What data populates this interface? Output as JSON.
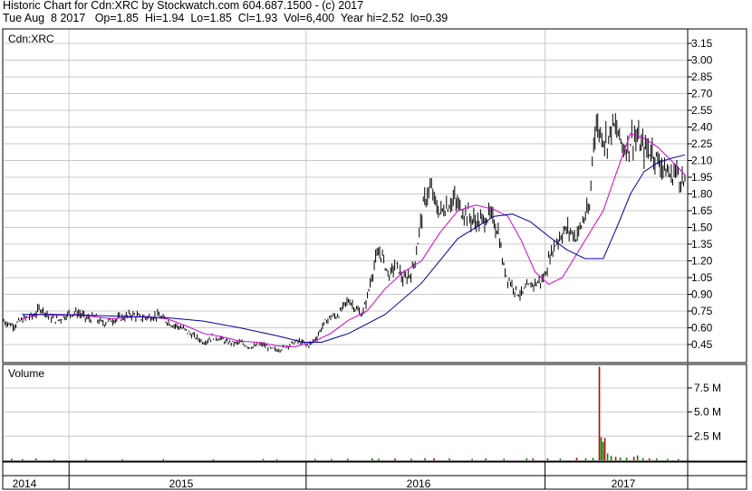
{
  "header": {
    "line1": "Historic Chart for Cdn:XRC by Stockwatch.com 604.687.1500 - (c) 2017",
    "line2": "Tue Aug  8 2017   Op=1.85  Hi=1.94  Lo=1.85  Cl=1.93  Vol=6,400  Year hi=2.52  lo=0.39"
  },
  "chart_data": [
    {
      "type": "line",
      "title": "Cdn:XRC",
      "ylim": [
        0.3,
        3.25
      ],
      "y_ticks": [
        "3.15",
        "3.00",
        "2.85",
        "2.70",
        "2.55",
        "2.40",
        "2.25",
        "2.10",
        "1.95",
        "1.80",
        "1.65",
        "1.50",
        "1.35",
        "1.20",
        "1.05",
        "0.90",
        "0.75",
        "0.60",
        "0.45"
      ],
      "x_labels": [
        "2014",
        "2015",
        "2016",
        "2017"
      ],
      "grid": true,
      "series": [
        {
          "style": "price-bars",
          "color": "#000000",
          "x": [
            0,
            5,
            10,
            15,
            20,
            25,
            30,
            35,
            40,
            45,
            50,
            55,
            60,
            65,
            70,
            75,
            80,
            85,
            90,
            95,
            100,
            105,
            110,
            115,
            120,
            125,
            130,
            135,
            140,
            145,
            150,
            155,
            160,
            165,
            170,
            175,
            180,
            185,
            190,
            195,
            200,
            205,
            210,
            215,
            220,
            225,
            230,
            235,
            240,
            245,
            250,
            255,
            260,
            265,
            270,
            275,
            280,
            285,
            290,
            295,
            300,
            305,
            310,
            315,
            320,
            325,
            330,
            335,
            340,
            345,
            350,
            355,
            360,
            365,
            370,
            375,
            380,
            385,
            390,
            395,
            400,
            405,
            410,
            415,
            420,
            425,
            430,
            435,
            440,
            445,
            450,
            455,
            460,
            465,
            470,
            475,
            480,
            485,
            490,
            495,
            500,
            505,
            510,
            515,
            520,
            525,
            530,
            535,
            540,
            545,
            550,
            555,
            560,
            565,
            570,
            575,
            580,
            585,
            590,
            595,
            600,
            605,
            610,
            615,
            620,
            625,
            630,
            635,
            640,
            645,
            650,
            655,
            660,
            665,
            670,
            675,
            680,
            685,
            690,
            695,
            700,
            705,
            710,
            715,
            720,
            725,
            730,
            735,
            740,
            745,
            750
          ],
          "values": [
            0.66,
            0.64,
            0.62,
            0.64,
            0.67,
            0.69,
            0.7,
            0.72,
            0.78,
            0.75,
            0.7,
            0.68,
            0.67,
            0.69,
            0.72,
            0.73,
            0.74,
            0.72,
            0.69,
            0.68,
            0.7,
            0.66,
            0.64,
            0.66,
            0.67,
            0.68,
            0.69,
            0.7,
            0.72,
            0.71,
            0.69,
            0.69,
            0.7,
            0.7,
            0.71,
            0.68,
            0.66,
            0.63,
            0.62,
            0.6,
            0.58,
            0.55,
            0.52,
            0.5,
            0.47,
            0.49,
            0.52,
            0.51,
            0.5,
            0.47,
            0.47,
            0.46,
            0.47,
            0.45,
            0.43,
            0.43,
            0.44,
            0.45,
            0.43,
            0.41,
            0.4,
            0.41,
            0.43,
            0.45,
            0.47,
            0.48,
            0.46,
            0.44,
            0.47,
            0.52,
            0.6,
            0.66,
            0.7,
            0.7,
            0.73,
            0.8,
            0.85,
            0.8,
            0.75,
            0.72,
            0.86,
            1.06,
            1.22,
            1.28,
            1.16,
            1.06,
            1.16,
            1.13,
            1.02,
            1.06,
            1.11,
            1.31,
            1.6,
            1.78,
            1.85,
            1.72,
            1.63,
            1.67,
            1.71,
            1.75,
            1.7,
            1.64,
            1.63,
            1.57,
            1.55,
            1.55,
            1.58,
            1.61,
            1.55,
            1.45,
            1.15,
            1.05,
            0.98,
            0.92,
            0.9,
            0.95,
            0.98,
            1.0,
            1.01,
            1.05,
            1.2,
            1.32,
            1.39,
            1.45,
            1.48,
            1.46,
            1.42,
            1.5,
            1.6,
            1.65,
            2.4,
            2.38,
            2.32,
            2.27,
            2.42,
            2.36,
            2.26,
            2.2,
            2.28,
            2.32,
            2.25,
            2.2,
            2.2,
            2.18,
            2.1,
            2.06,
            2.0,
            1.95,
            2.02,
            1.95,
            1.88
          ]
        },
        {
          "style": "moving-average",
          "color": "#d000d0",
          "x": [
            20,
            40,
            60,
            80,
            100,
            120,
            140,
            160,
            180,
            200,
            220,
            240,
            260,
            280,
            300,
            320,
            340,
            360,
            380,
            400,
            420,
            440,
            460,
            480,
            500,
            520,
            540,
            555,
            570,
            585,
            600,
            615,
            630,
            645,
            660,
            675,
            690,
            705,
            720,
            735,
            750
          ],
          "values": [
            0.68,
            0.72,
            0.71,
            0.72,
            0.7,
            0.68,
            0.7,
            0.7,
            0.68,
            0.62,
            0.55,
            0.52,
            0.48,
            0.47,
            0.44,
            0.43,
            0.47,
            0.55,
            0.67,
            0.75,
            0.95,
            1.1,
            1.2,
            1.45,
            1.65,
            1.7,
            1.66,
            1.6,
            1.38,
            1.1,
            0.99,
            1.05,
            1.25,
            1.45,
            1.65,
            2.0,
            2.34,
            2.3,
            2.22,
            2.1,
            1.97
          ]
        },
        {
          "style": "moving-average",
          "color": "#0000a0",
          "x": [
            20,
            60,
            100,
            140,
            180,
            220,
            260,
            300,
            330,
            350,
            380,
            420,
            460,
            500,
            540,
            560,
            580,
            600,
            620,
            640,
            660,
            675,
            690,
            705,
            720,
            735,
            750
          ],
          "values": [
            0.72,
            0.72,
            0.71,
            0.7,
            0.69,
            0.66,
            0.6,
            0.53,
            0.47,
            0.47,
            0.55,
            0.72,
            1.0,
            1.4,
            1.6,
            1.62,
            1.55,
            1.42,
            1.3,
            1.22,
            1.22,
            1.5,
            1.8,
            2.0,
            2.08,
            2.12,
            2.15
          ]
        }
      ]
    },
    {
      "type": "bar",
      "title": "Volume",
      "ylim": [
        0,
        10000000
      ],
      "y_ticks": [
        "7.5 M",
        "5.0 M",
        "2.5 M"
      ],
      "grid": true,
      "bars": [
        {
          "x": 8,
          "v": 150000
        },
        {
          "x": 20,
          "v": 120000
        },
        {
          "x": 35,
          "v": 180000
        },
        {
          "x": 55,
          "v": 100000
        },
        {
          "x": 90,
          "v": 120000
        },
        {
          "x": 130,
          "v": 90000
        },
        {
          "x": 175,
          "v": 110000
        },
        {
          "x": 230,
          "v": 100000
        },
        {
          "x": 285,
          "v": 130000
        },
        {
          "x": 300,
          "v": 90000
        },
        {
          "x": 342,
          "v": 140000
        },
        {
          "x": 360,
          "v": 120000
        },
        {
          "x": 378,
          "v": 150000
        },
        {
          "x": 405,
          "v": 200000
        },
        {
          "x": 412,
          "v": 160000
        },
        {
          "x": 430,
          "v": 170000
        },
        {
          "x": 448,
          "v": 160000
        },
        {
          "x": 463,
          "v": 210000
        },
        {
          "x": 473,
          "v": 190000
        },
        {
          "x": 490,
          "v": 190000
        },
        {
          "x": 515,
          "v": 150000
        },
        {
          "x": 530,
          "v": 170000
        },
        {
          "x": 550,
          "v": 160000
        },
        {
          "x": 575,
          "v": 210000
        },
        {
          "x": 582,
          "v": 190000
        },
        {
          "x": 598,
          "v": 200000
        },
        {
          "x": 612,
          "v": 170000
        },
        {
          "x": 630,
          "v": 260000
        },
        {
          "x": 640,
          "v": 190000
        },
        {
          "x": 648,
          "v": 240000
        },
        {
          "x": 655,
          "v": 9700000
        },
        {
          "x": 657,
          "v": 2400000
        },
        {
          "x": 659,
          "v": 1900000
        },
        {
          "x": 661,
          "v": 2300000
        },
        {
          "x": 664,
          "v": 700000
        },
        {
          "x": 668,
          "v": 450000
        },
        {
          "x": 673,
          "v": 350000
        },
        {
          "x": 678,
          "v": 300000
        },
        {
          "x": 685,
          "v": 280000
        },
        {
          "x": 693,
          "v": 350000
        },
        {
          "x": 697,
          "v": 500000
        },
        {
          "x": 703,
          "v": 220000
        },
        {
          "x": 710,
          "v": 200000
        },
        {
          "x": 718,
          "v": 180000
        },
        {
          "x": 730,
          "v": 150000
        },
        {
          "x": 742,
          "v": 130000
        }
      ]
    }
  ]
}
